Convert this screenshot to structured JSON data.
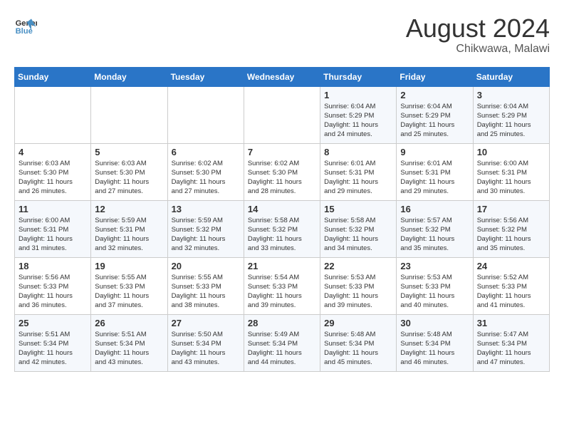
{
  "header": {
    "logo_line1": "General",
    "logo_line2": "Blue",
    "month_year": "August 2024",
    "location": "Chikwawa, Malawi"
  },
  "days_of_week": [
    "Sunday",
    "Monday",
    "Tuesday",
    "Wednesday",
    "Thursday",
    "Friday",
    "Saturday"
  ],
  "weeks": [
    [
      {
        "day": "",
        "info": ""
      },
      {
        "day": "",
        "info": ""
      },
      {
        "day": "",
        "info": ""
      },
      {
        "day": "",
        "info": ""
      },
      {
        "day": "1",
        "info": "Sunrise: 6:04 AM\nSunset: 5:29 PM\nDaylight: 11 hours\nand 24 minutes."
      },
      {
        "day": "2",
        "info": "Sunrise: 6:04 AM\nSunset: 5:29 PM\nDaylight: 11 hours\nand 25 minutes."
      },
      {
        "day": "3",
        "info": "Sunrise: 6:04 AM\nSunset: 5:29 PM\nDaylight: 11 hours\nand 25 minutes."
      }
    ],
    [
      {
        "day": "4",
        "info": "Sunrise: 6:03 AM\nSunset: 5:30 PM\nDaylight: 11 hours\nand 26 minutes."
      },
      {
        "day": "5",
        "info": "Sunrise: 6:03 AM\nSunset: 5:30 PM\nDaylight: 11 hours\nand 27 minutes."
      },
      {
        "day": "6",
        "info": "Sunrise: 6:02 AM\nSunset: 5:30 PM\nDaylight: 11 hours\nand 27 minutes."
      },
      {
        "day": "7",
        "info": "Sunrise: 6:02 AM\nSunset: 5:30 PM\nDaylight: 11 hours\nand 28 minutes."
      },
      {
        "day": "8",
        "info": "Sunrise: 6:01 AM\nSunset: 5:31 PM\nDaylight: 11 hours\nand 29 minutes."
      },
      {
        "day": "9",
        "info": "Sunrise: 6:01 AM\nSunset: 5:31 PM\nDaylight: 11 hours\nand 29 minutes."
      },
      {
        "day": "10",
        "info": "Sunrise: 6:00 AM\nSunset: 5:31 PM\nDaylight: 11 hours\nand 30 minutes."
      }
    ],
    [
      {
        "day": "11",
        "info": "Sunrise: 6:00 AM\nSunset: 5:31 PM\nDaylight: 11 hours\nand 31 minutes."
      },
      {
        "day": "12",
        "info": "Sunrise: 5:59 AM\nSunset: 5:31 PM\nDaylight: 11 hours\nand 32 minutes."
      },
      {
        "day": "13",
        "info": "Sunrise: 5:59 AM\nSunset: 5:32 PM\nDaylight: 11 hours\nand 32 minutes."
      },
      {
        "day": "14",
        "info": "Sunrise: 5:58 AM\nSunset: 5:32 PM\nDaylight: 11 hours\nand 33 minutes."
      },
      {
        "day": "15",
        "info": "Sunrise: 5:58 AM\nSunset: 5:32 PM\nDaylight: 11 hours\nand 34 minutes."
      },
      {
        "day": "16",
        "info": "Sunrise: 5:57 AM\nSunset: 5:32 PM\nDaylight: 11 hours\nand 35 minutes."
      },
      {
        "day": "17",
        "info": "Sunrise: 5:56 AM\nSunset: 5:32 PM\nDaylight: 11 hours\nand 35 minutes."
      }
    ],
    [
      {
        "day": "18",
        "info": "Sunrise: 5:56 AM\nSunset: 5:33 PM\nDaylight: 11 hours\nand 36 minutes."
      },
      {
        "day": "19",
        "info": "Sunrise: 5:55 AM\nSunset: 5:33 PM\nDaylight: 11 hours\nand 37 minutes."
      },
      {
        "day": "20",
        "info": "Sunrise: 5:55 AM\nSunset: 5:33 PM\nDaylight: 11 hours\nand 38 minutes."
      },
      {
        "day": "21",
        "info": "Sunrise: 5:54 AM\nSunset: 5:33 PM\nDaylight: 11 hours\nand 39 minutes."
      },
      {
        "day": "22",
        "info": "Sunrise: 5:53 AM\nSunset: 5:33 PM\nDaylight: 11 hours\nand 39 minutes."
      },
      {
        "day": "23",
        "info": "Sunrise: 5:53 AM\nSunset: 5:33 PM\nDaylight: 11 hours\nand 40 minutes."
      },
      {
        "day": "24",
        "info": "Sunrise: 5:52 AM\nSunset: 5:33 PM\nDaylight: 11 hours\nand 41 minutes."
      }
    ],
    [
      {
        "day": "25",
        "info": "Sunrise: 5:51 AM\nSunset: 5:34 PM\nDaylight: 11 hours\nand 42 minutes."
      },
      {
        "day": "26",
        "info": "Sunrise: 5:51 AM\nSunset: 5:34 PM\nDaylight: 11 hours\nand 43 minutes."
      },
      {
        "day": "27",
        "info": "Sunrise: 5:50 AM\nSunset: 5:34 PM\nDaylight: 11 hours\nand 43 minutes."
      },
      {
        "day": "28",
        "info": "Sunrise: 5:49 AM\nSunset: 5:34 PM\nDaylight: 11 hours\nand 44 minutes."
      },
      {
        "day": "29",
        "info": "Sunrise: 5:48 AM\nSunset: 5:34 PM\nDaylight: 11 hours\nand 45 minutes."
      },
      {
        "day": "30",
        "info": "Sunrise: 5:48 AM\nSunset: 5:34 PM\nDaylight: 11 hours\nand 46 minutes."
      },
      {
        "day": "31",
        "info": "Sunrise: 5:47 AM\nSunset: 5:34 PM\nDaylight: 11 hours\nand 47 minutes."
      }
    ]
  ]
}
